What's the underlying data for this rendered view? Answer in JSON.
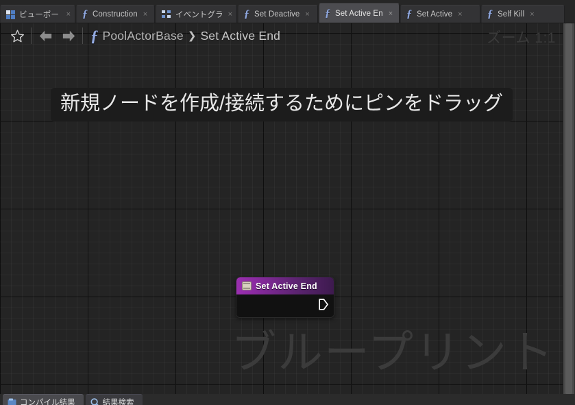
{
  "tabbar": {
    "tabs": [
      {
        "label": "ビューポート",
        "icon": "viewport-grid-icon",
        "active": false,
        "close": "×"
      },
      {
        "label": "Construction",
        "icon": "function-fx-icon",
        "active": false,
        "close": "×"
      },
      {
        "label": "イベントグラフ",
        "icon": "event-graph-icon",
        "active": false,
        "close": "×"
      },
      {
        "label": "Set Deactive",
        "icon": "function-fx-icon",
        "active": false,
        "close": "×"
      },
      {
        "label": "Set Active En",
        "icon": "function-fx-icon",
        "active": true,
        "close": "×"
      },
      {
        "label": "Set Active",
        "icon": "function-fx-icon",
        "active": false,
        "close": "×"
      },
      {
        "label": "Self Kill",
        "icon": "function-fx-icon",
        "active": false,
        "close": "×"
      }
    ]
  },
  "breadcrumb": {
    "favorite_icon": "star-icon",
    "back_icon": "arrow-left-icon",
    "forward_icon": "arrow-right-icon",
    "graph_icon": "function-fx-icon",
    "root": "PoolActorBase",
    "separator": "❯",
    "leaf": "Set Active End"
  },
  "canvas": {
    "zoom_label": "ズーム 1:1",
    "instruction": "新規ノードを作成/接続するためにピンをドラッグ",
    "watermark": "ブループリント",
    "grid_color": "#242424",
    "accent_color": "#9b2fb0"
  },
  "node": {
    "title": "Set Active End",
    "icon": "function-node-icon",
    "exec_pin": "exec-output-pin",
    "header_color_start": "#9b2fb0",
    "header_color_end": "#3d1a4e",
    "body_color": "#111111"
  },
  "bottom_panel": {
    "tabs": [
      {
        "label": "コンパイル結果",
        "icon": "compiler-results-icon",
        "active": true
      },
      {
        "label": "結果検索",
        "icon": "find-results-icon",
        "active": false
      }
    ]
  }
}
